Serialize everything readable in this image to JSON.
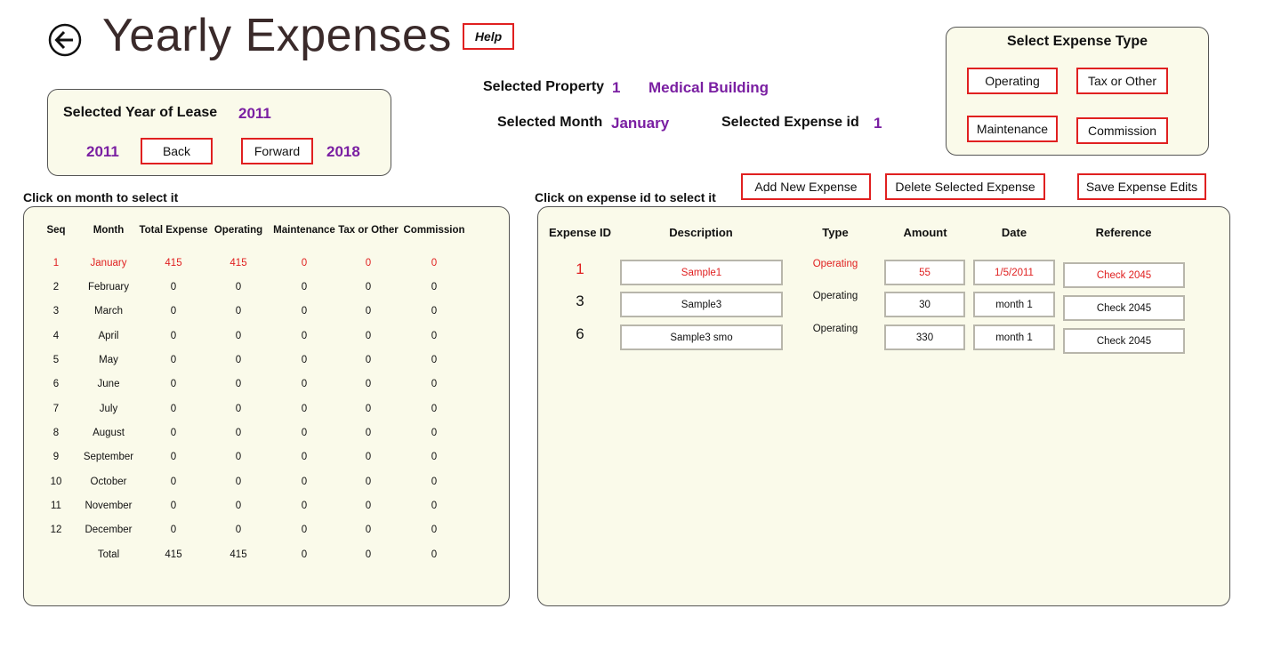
{
  "header": {
    "title": "Yearly Expenses",
    "help_label": "Help"
  },
  "year_panel": {
    "label": "Selected Year of Lease",
    "selected_year": "2011",
    "min_year": "2011",
    "back_label": "Back",
    "forward_label": "Forward",
    "max_year": "2018"
  },
  "selection": {
    "property_label": "Selected Property",
    "property_id": "1",
    "property_name": "Medical Building",
    "month_label": "Selected Month",
    "month_value": "January",
    "expense_label": "Selected Expense id",
    "expense_value": "1"
  },
  "expense_type": {
    "title": "Select Expense Type",
    "operating": "Operating",
    "tax": "Tax or Other",
    "maintenance": "Maintenance",
    "commission": "Commission"
  },
  "actions": {
    "add": "Add New Expense",
    "delete": "Delete Selected Expense",
    "save": "Save Expense Edits"
  },
  "month_table": {
    "instruction": "Click on month to select it",
    "headers": [
      "Seq",
      "Month",
      "Total Expense",
      "Operating",
      "Maintenance",
      "Tax or Other",
      "Commission"
    ],
    "rows": [
      [
        "1",
        "January",
        "415",
        "415",
        "0",
        "0",
        "0"
      ],
      [
        "2",
        "February",
        "0",
        "0",
        "0",
        "0",
        "0"
      ],
      [
        "3",
        "March",
        "0",
        "0",
        "0",
        "0",
        "0"
      ],
      [
        "4",
        "April",
        "0",
        "0",
        "0",
        "0",
        "0"
      ],
      [
        "5",
        "May",
        "0",
        "0",
        "0",
        "0",
        "0"
      ],
      [
        "6",
        "June",
        "0",
        "0",
        "0",
        "0",
        "0"
      ],
      [
        "7",
        "July",
        "0",
        "0",
        "0",
        "0",
        "0"
      ],
      [
        "8",
        "August",
        "0",
        "0",
        "0",
        "0",
        "0"
      ],
      [
        "9",
        "September",
        "0",
        "0",
        "0",
        "0",
        "0"
      ],
      [
        "10",
        "October",
        "0",
        "0",
        "0",
        "0",
        "0"
      ],
      [
        "11",
        "November",
        "0",
        "0",
        "0",
        "0",
        "0"
      ],
      [
        "12",
        "December",
        "0",
        "0",
        "0",
        "0",
        "0"
      ],
      [
        "",
        "Total",
        "415",
        "415",
        "0",
        "0",
        "0"
      ]
    ]
  },
  "expense_table": {
    "instruction": "Click on expense id to select it",
    "headers": [
      "Expense ID",
      "Description",
      "Type",
      "Amount",
      "Date",
      "Reference"
    ],
    "rows": [
      {
        "id": "1",
        "description": "Sample1",
        "type": "Operating",
        "amount": "55",
        "date": "1/5/2011",
        "reference": "Check 2045"
      },
      {
        "id": "3",
        "description": "Sample3",
        "type": "Operating",
        "amount": "30",
        "date": "month 1",
        "reference": "Check 2045"
      },
      {
        "id": "6",
        "description": "Sample3 smo",
        "type": "Operating",
        "amount": "330",
        "date": "month 1",
        "reference": "Check 2045"
      }
    ]
  },
  "colors": {
    "accent_red": "#e02020",
    "purple": "#7a1fa2",
    "panel_bg": "#fafaea"
  }
}
